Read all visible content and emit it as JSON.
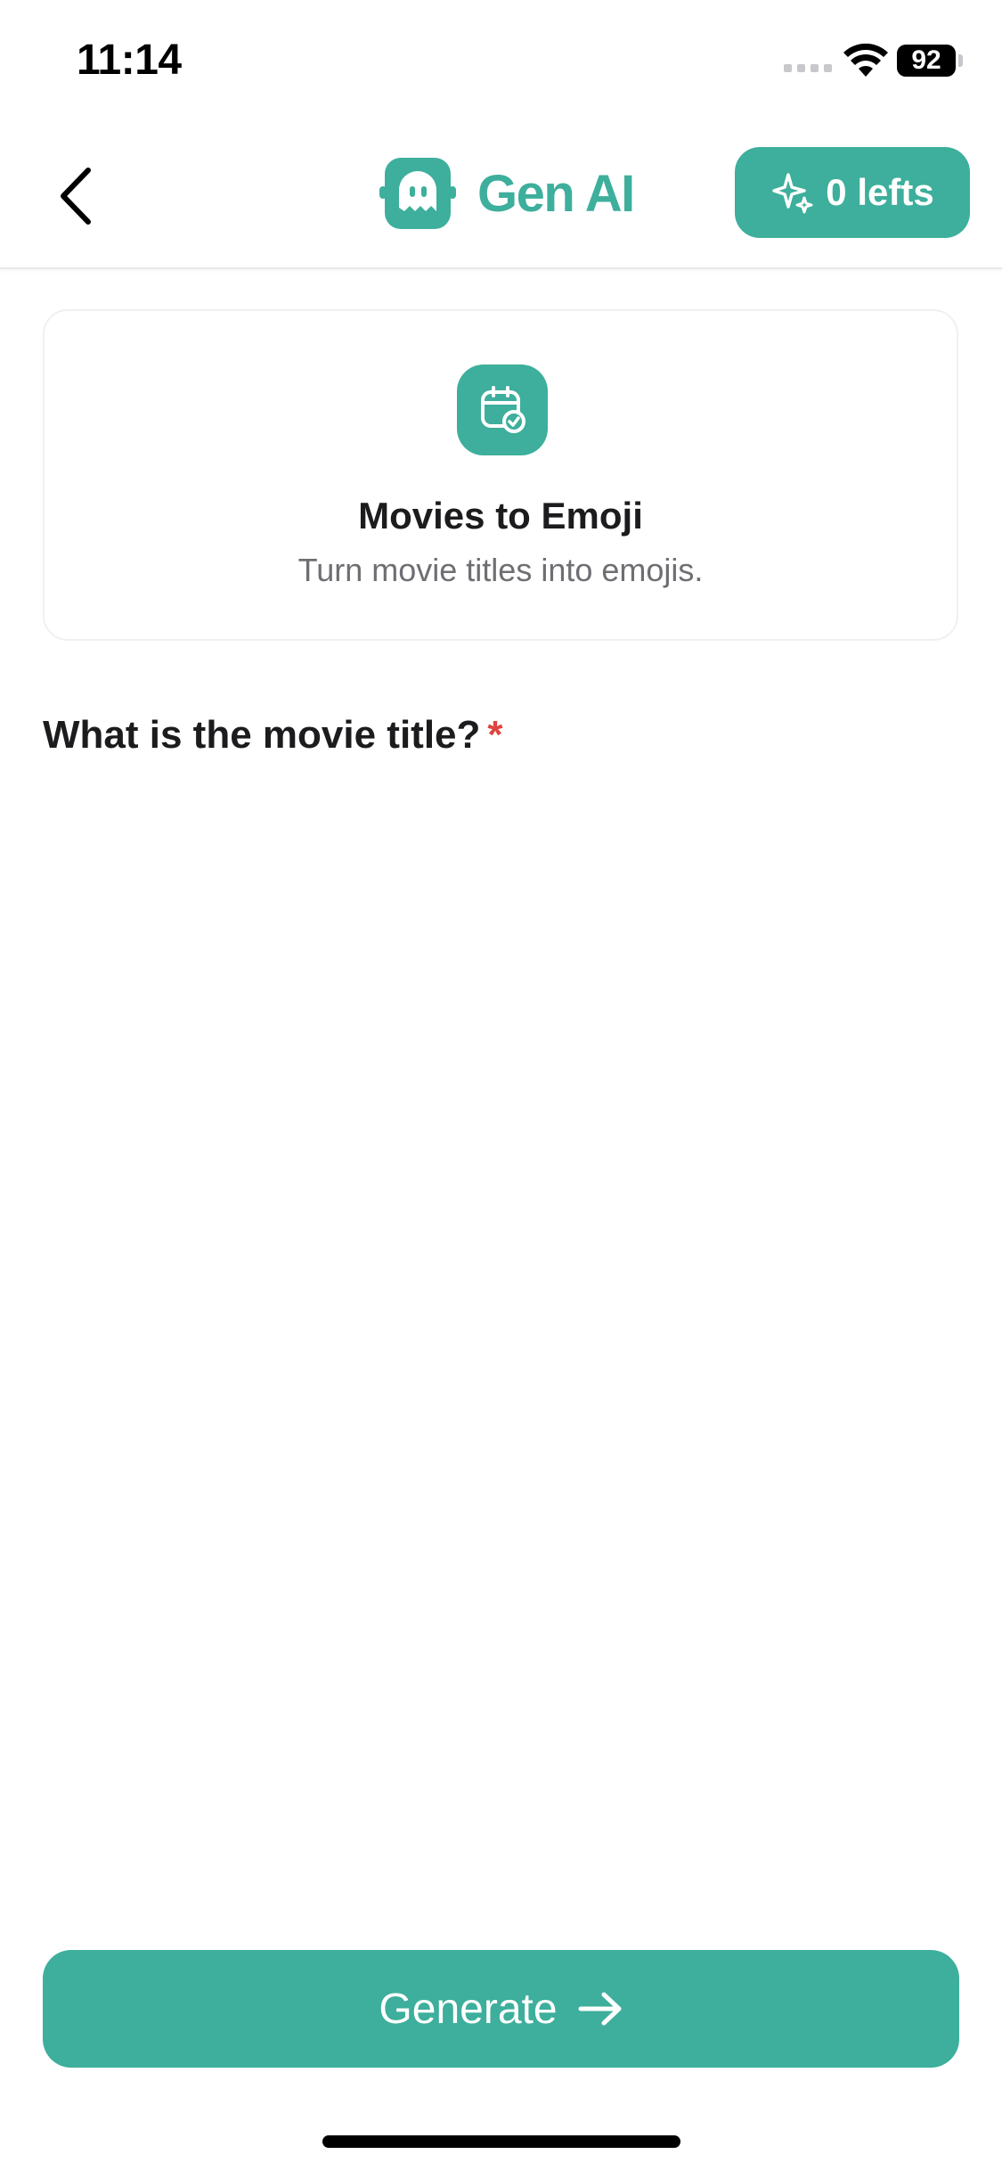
{
  "status_bar": {
    "time": "11:14",
    "battery": "92"
  },
  "nav": {
    "back_icon": "chevron-left-icon",
    "brand_name": "Gen AI",
    "brand_icon": "ghost-chat-icon",
    "credits_label": "0 lefts",
    "credits_icon": "sparkle-icon"
  },
  "tool": {
    "icon": "calendar-check-icon",
    "title": "Movies to Emoji",
    "description": "Turn movie titles into emojis."
  },
  "form": {
    "question": "What is the movie title?",
    "required_marker": "*",
    "answer_value": ""
  },
  "actions": {
    "generate_label": "Generate",
    "generate_icon": "arrow-right-icon"
  },
  "colors": {
    "accent": "#3daf9c",
    "required": "#e0443e"
  }
}
